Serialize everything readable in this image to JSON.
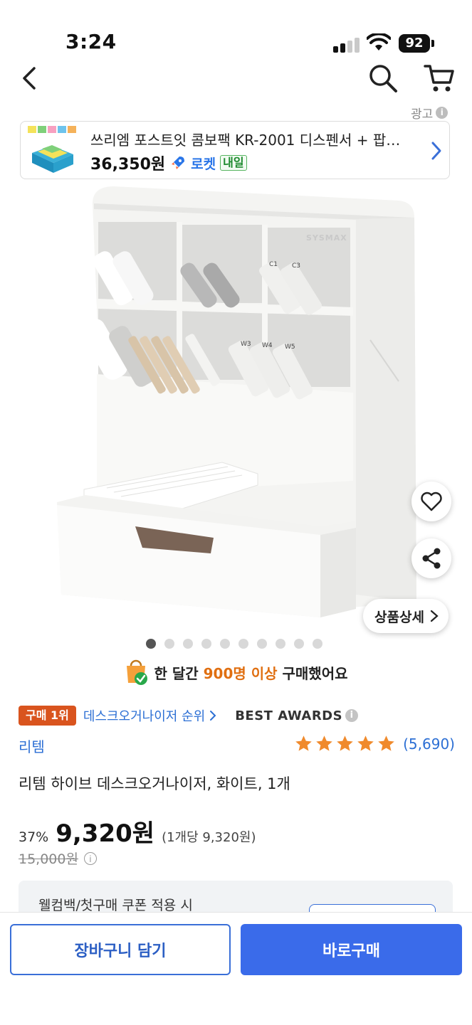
{
  "status_bar": {
    "time": "3:24",
    "battery": "92"
  },
  "ad": {
    "label": "광고",
    "title": "쓰리엠 포스트잇 콤보팩 KR-2001 디스펜서 + 팝…",
    "price": "36,350원",
    "rocket": "로켓",
    "delivery_badge": "내일"
  },
  "product_image": {
    "brand_text": "SYSMAX",
    "detail_button": "상품상세",
    "dot_count": 10,
    "active_dot": 0,
    "marker_labels": [
      "C1",
      "C3",
      "W3",
      "W4",
      "W5"
    ]
  },
  "purchase_note": {
    "pre": "한 달간 ",
    "highlight": "900명 이상",
    "post": " 구매했어요"
  },
  "rank": {
    "badge": "구매 1위",
    "link": "데스크오거나이저 순위",
    "awards": "BEST AWARDS"
  },
  "brand": "리템",
  "rating": {
    "stars": 5,
    "count": "(5,690)"
  },
  "product_title": "리템 하이브 데스크오거나이저, 화이트, 1개",
  "price": {
    "discount": "37%",
    "sale": "9,320원",
    "unit": "(1개당 9,320원)",
    "original": "15,000원"
  },
  "coupon": {
    "text": "웰컴백/첫구매 쿠폰 적용 시"
  },
  "bottom": {
    "cart_button": "장바구니 담기",
    "buy_button": "바로구매"
  },
  "colors": {
    "accent_blue": "#3a6bea",
    "link_blue": "#2c6fd4",
    "rank_orange": "#d9541e",
    "star_orange": "#f08a2c"
  }
}
